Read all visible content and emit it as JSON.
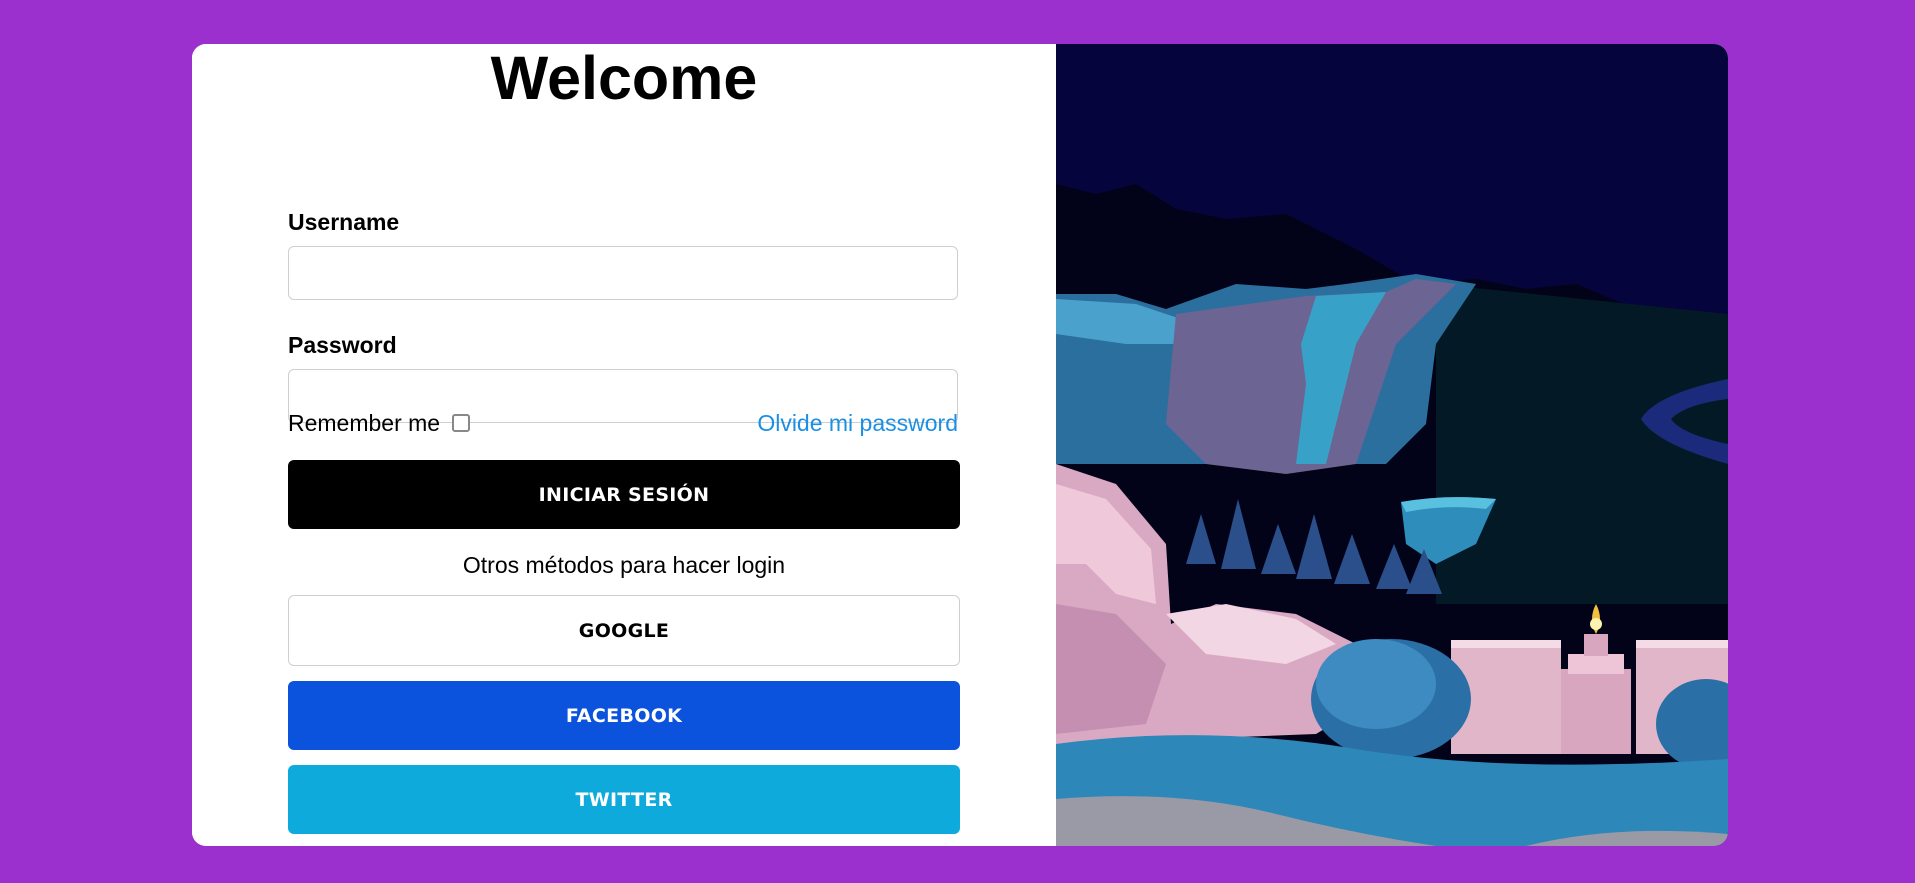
{
  "form": {
    "title": "Welcome",
    "username_label": "Username",
    "username_value": "",
    "password_label": "Password",
    "password_value": "",
    "remember_label": "Remember me",
    "remember_checked": false,
    "forgot_link": "Olvide mi password",
    "login_button": "INICIAR SESIÓN",
    "other_methods": "Otros métodos para hacer login",
    "google_button": "GOOGLE",
    "facebook_button": "FACEBOOK",
    "twitter_button": "TWITTER"
  },
  "colors": {
    "page_background": "#9b30cf",
    "card_background": "#ffffff",
    "login_button": "#000000",
    "facebook_button": "#0b52dc",
    "twitter_button": "#0eaadb",
    "link": "#1a8fe3"
  },
  "illustration": {
    "subject": "night-landscape-with-cliffs-and-shrine"
  }
}
